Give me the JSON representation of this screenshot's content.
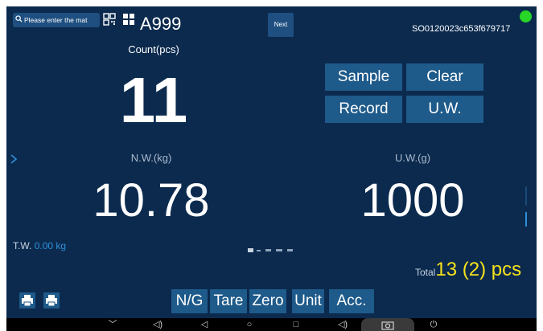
{
  "search": {
    "placeholder_text": "Please enter the mat"
  },
  "header": {
    "code": "A999",
    "next_label": "Next",
    "serial": "SO0120023c653f679717"
  },
  "count": {
    "label": "Count(pcs)",
    "value": "11"
  },
  "buttons": {
    "sample": "Sample",
    "clear": "Clear",
    "record": "Record",
    "uw": "U.W."
  },
  "net_weight": {
    "label": "N.W.(kg)",
    "value": "10.78"
  },
  "unit_weight": {
    "label": "U.W.(g)",
    "value": "1000"
  },
  "tare_weight": {
    "label": "T.W.",
    "value": "0.00 kg"
  },
  "total": {
    "label": "Total",
    "value": "13 (2) pcs"
  },
  "function_buttons": {
    "ng": "N/G",
    "tare": "Tare",
    "zero": "Zero",
    "unit": "Unit",
    "acc": "Acc."
  },
  "nav_glyphs": {
    "collapse": "﹀",
    "volume_down": "◁)",
    "back": "◁",
    "home": "○",
    "recents": "□",
    "volume_up": "◁)",
    "power": "⏻"
  },
  "colors": {
    "background": "#0b2a4e",
    "button": "#1e5a8a",
    "accent_blue": "#2f8fd8",
    "total_yellow": "#f5e11c",
    "status_green": "#27d627"
  },
  "icons": [
    "search-icon",
    "qr-code-icon",
    "grid-icon",
    "status-dot-icon",
    "chevron-right-icon",
    "print-icon",
    "camera-icon"
  ]
}
